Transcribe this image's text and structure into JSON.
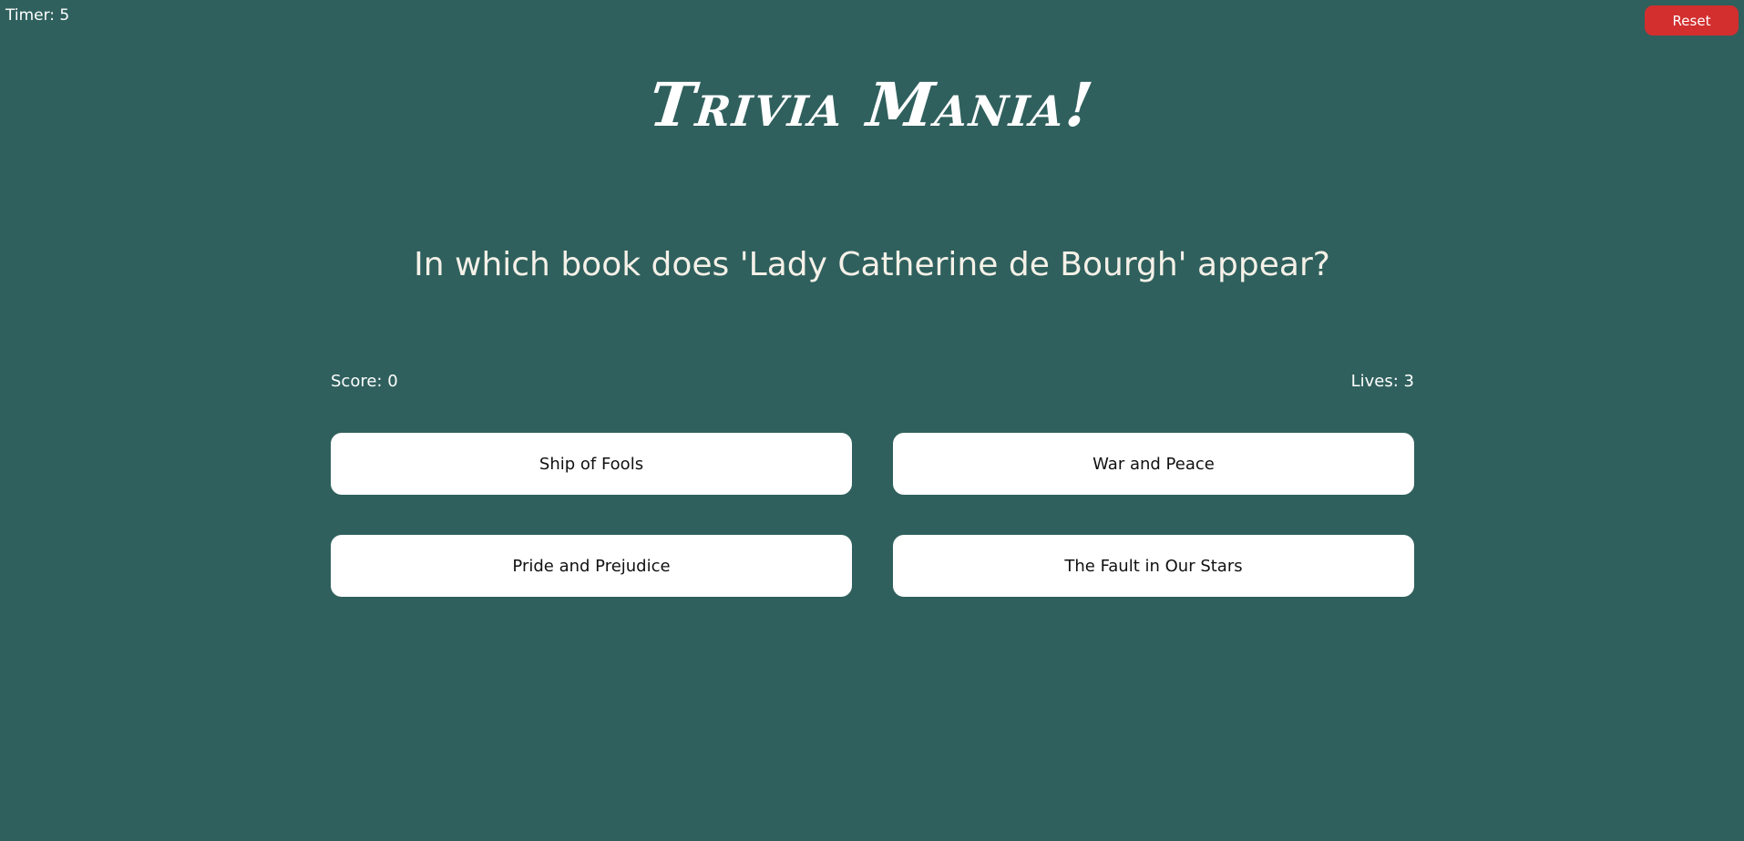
{
  "timer": {
    "label": "Timer: 5"
  },
  "reset": {
    "label": "Reset"
  },
  "header": {
    "title": "Trivia Mania!"
  },
  "question": {
    "text": "In which book does 'Lady Catherine de Bourgh' appear?"
  },
  "stats": {
    "score": "Score: 0",
    "lives": "Lives: 3"
  },
  "answers": [
    {
      "label": "Ship of Fools"
    },
    {
      "label": "War and Peace"
    },
    {
      "label": "Pride and Prejudice"
    },
    {
      "label": "The Fault in Our Stars"
    }
  ],
  "colors": {
    "background": "#2f605d",
    "reset_button": "#d32f2f",
    "answer_button": "#ffffff"
  }
}
